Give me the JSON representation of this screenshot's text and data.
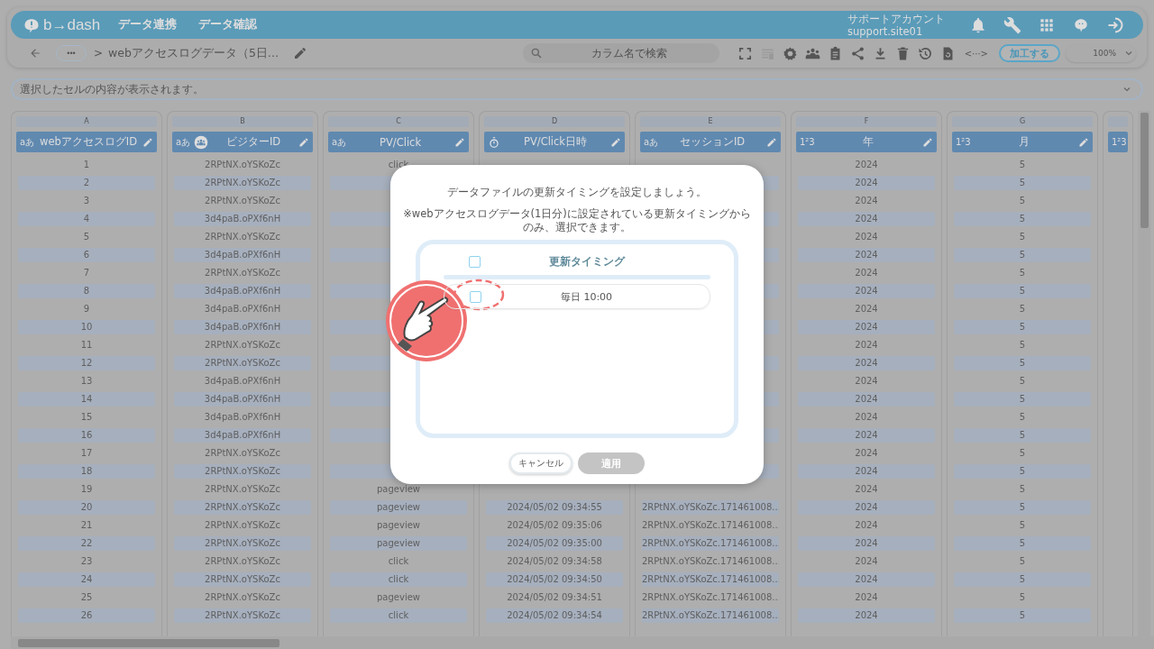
{
  "header": {
    "logo": "b→dash",
    "nav": [
      {
        "label": "データ連携",
        "selected": false
      },
      {
        "label": "データ確認",
        "selected": false
      }
    ],
    "account": {
      "name": "サポートアカウント",
      "id": "support.site01"
    }
  },
  "toolbar": {
    "more": "•••",
    "separator": ">",
    "title": "webアクセスログデータ（5日…",
    "search": {
      "placeholder": "カラム名で検索"
    },
    "code_label": "<···>",
    "process_button": "加工する",
    "zoom": "100%"
  },
  "cell_preview": {
    "placeholder": "選択したセルの内容が表示されます。"
  },
  "table": {
    "columns": [
      {
        "letter": "A",
        "name": "webアクセスログID",
        "kind": "text",
        "type_label": "aあ",
        "user_key": false
      },
      {
        "letter": "B",
        "name": "ビジターID",
        "kind": "text",
        "type_label": "aあ",
        "user_key": true
      },
      {
        "letter": "C",
        "name": "PV/Click",
        "kind": "text",
        "type_label": "aあ",
        "user_key": false
      },
      {
        "letter": "D",
        "name": "PV/Click日時",
        "kind": "datetime",
        "user_key": false
      },
      {
        "letter": "E",
        "name": "セッションID",
        "kind": "text",
        "type_label": "aあ",
        "user_key": false
      },
      {
        "letter": "F",
        "name": "年",
        "kind": "number",
        "type_label": "1²3",
        "user_key": false
      },
      {
        "letter": "G",
        "name": "月",
        "kind": "number",
        "type_label": "1²3",
        "user_key": false
      },
      {
        "kind": "number",
        "type_label": "1²3"
      }
    ],
    "rows": [
      {
        "cells": [
          "1",
          "2RPtNX.oYSKoZc",
          "click",
          null,
          null,
          "2024",
          "5"
        ]
      },
      {
        "cells": [
          "2",
          "2RPtNX.oYSKoZc",
          null,
          null,
          null,
          "2024",
          "5"
        ]
      },
      {
        "cells": [
          "3",
          "2RPtNX.oYSKoZc",
          null,
          null,
          null,
          "2024",
          "5"
        ]
      },
      {
        "cells": [
          "4",
          "3d4paB.oPXf6nH",
          null,
          null,
          null,
          "2024",
          "5"
        ]
      },
      {
        "cells": [
          "5",
          "2RPtNX.oYSKoZc",
          null,
          null,
          null,
          "2024",
          "5"
        ]
      },
      {
        "cells": [
          "6",
          "3d4paB.oPXf6nH",
          null,
          null,
          null,
          "2024",
          "5"
        ]
      },
      {
        "cells": [
          "7",
          "2RPtNX.oYSKoZc",
          null,
          null,
          null,
          "2024",
          "5"
        ]
      },
      {
        "cells": [
          "8",
          "3d4paB.oPXf6nH",
          null,
          null,
          null,
          "2024",
          "5"
        ]
      },
      {
        "cells": [
          "9",
          "3d4paB.oPXf6nH",
          null,
          null,
          null,
          "2024",
          "5"
        ]
      },
      {
        "cells": [
          "10",
          "3d4paB.oPXf6nH",
          null,
          null,
          null,
          "2024",
          "5"
        ]
      },
      {
        "cells": [
          "11",
          "2RPtNX.oYSKoZc",
          null,
          null,
          null,
          "2024",
          "5"
        ]
      },
      {
        "cells": [
          "12",
          "2RPtNX.oYSKoZc",
          null,
          null,
          null,
          "2024",
          "5"
        ]
      },
      {
        "cells": [
          "13",
          "3d4paB.oPXf6nH",
          null,
          null,
          null,
          "2024",
          "5"
        ]
      },
      {
        "cells": [
          "14",
          "3d4paB.oPXf6nH",
          null,
          null,
          null,
          "2024",
          "5"
        ]
      },
      {
        "cells": [
          "15",
          "3d4paB.oPXf6nH",
          null,
          null,
          null,
          "2024",
          "5"
        ]
      },
      {
        "cells": [
          "16",
          "3d4paB.oPXf6nH",
          null,
          null,
          null,
          "2024",
          "5"
        ]
      },
      {
        "cells": [
          "17",
          "2RPtNX.oYSKoZc",
          null,
          null,
          null,
          "2024",
          "5"
        ]
      },
      {
        "cells": [
          "18",
          "2RPtNX.oYSKoZc",
          null,
          null,
          null,
          "2024",
          "5"
        ]
      },
      {
        "cells": [
          "19",
          "2RPtNX.oYSKoZc",
          "pageview",
          null,
          null,
          "2024",
          "5"
        ]
      },
      {
        "cells": [
          "20",
          "2RPtNX.oYSKoZc",
          "pageview",
          "2024/05/02 09:34:55",
          "2RPtNX.oYSKoZc.171461008...",
          "2024",
          "5"
        ]
      },
      {
        "cells": [
          "21",
          "2RPtNX.oYSKoZc",
          "pageview",
          "2024/05/02 09:35:06",
          "2RPtNX.oYSKoZc.171461008...",
          "2024",
          "5"
        ]
      },
      {
        "cells": [
          "22",
          "2RPtNX.oYSKoZc",
          "pageview",
          "2024/05/02 09:35:00",
          "2RPtNX.oYSKoZc.171461008...",
          "2024",
          "5"
        ]
      },
      {
        "cells": [
          "23",
          "2RPtNX.oYSKoZc",
          "click",
          "2024/05/02 09:34:58",
          "2RPtNX.oYSKoZc.171461008...",
          "2024",
          "5"
        ]
      },
      {
        "cells": [
          "24",
          "2RPtNX.oYSKoZc",
          "click",
          "2024/05/02 09:34:50",
          "2RPtNX.oYSKoZc.171461008...",
          "2024",
          "5"
        ]
      },
      {
        "cells": [
          "25",
          "2RPtNX.oYSKoZc",
          "pageview",
          "2024/05/02 09:34:51",
          "2RPtNX.oYSKoZc.171461008...",
          "2024",
          "5"
        ]
      },
      {
        "cells": [
          "26",
          "2RPtNX.oYSKoZc",
          "click",
          "2024/05/02 09:34:54",
          "2RPtNX.oYSKoZc.171461008...",
          "2024",
          "5"
        ]
      }
    ]
  },
  "dialog": {
    "title": "データファイルの更新タイミングを設定しましょう。",
    "note": "※webアクセスログデータ(1日分)に設定されている更新タイミングからのみ、選択できます。",
    "list_header": {
      "label": "更新タイミング",
      "checked": false
    },
    "options": [
      {
        "label": "毎日 10:00",
        "checked": false,
        "highlighted": true
      }
    ],
    "cancel": "キャンセル",
    "apply": {
      "label": "適用",
      "disabled": true
    }
  }
}
